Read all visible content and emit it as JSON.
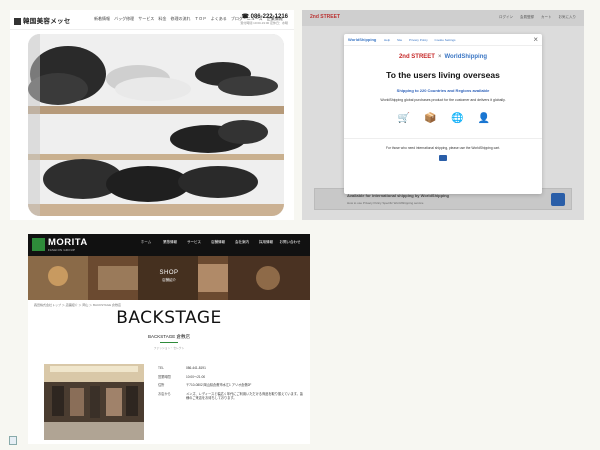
{
  "panel1": {
    "logo": "韓国美容メッセ",
    "nav": [
      "新着情報",
      "バッグ修理",
      "サービス",
      "料金",
      "修理の流れ",
      "ＴＯＰ",
      "よくある",
      "ご質問",
      "ブログ・ニュース",
      "企業情報"
    ],
    "tel": "086-222-1216",
    "tel_sub": "受付時間 10:00-19:00 定休日：水曜"
  },
  "panel2": {
    "header_logo": "2nd STREET",
    "header_icons": [
      "ログイン",
      "会員登録",
      "カート",
      "お気に入り"
    ],
    "bg_text": "",
    "modal": {
      "ws_label": "WorldShipping",
      "links": [
        "Help",
        "Site",
        "Privacy Policy",
        "Cookie Settings"
      ],
      "close": "×",
      "brand_left": "2nd STREET",
      "brand_x": "×",
      "brand_right": "WorldShipping",
      "title": "To the users living overseas",
      "shipping": "Shipping to 220 Countries and Regions available",
      "desc": "WorldShipping global purchases product for the customer and delivers it globally.",
      "footer": "For those who need international shipping, please use the WorldShipping cart."
    },
    "bottom_bar": {
      "title": "Available for international shipping by WorldShipping",
      "links": "How to use    Privacy Policy    Specific WorldShipping service"
    },
    "colors": {
      "brand_red": "#c62828",
      "ws_blue": "#2a5ea8"
    }
  },
  "panel3": {
    "logo": "MORITA",
    "logo_sub": "FASHION GROUP",
    "nav": [
      "ホーム",
      "業態情報",
      "サービス",
      "店舗情報",
      "会社案内",
      "採用情報",
      "お問い合わせ"
    ],
    "hero_title": "SHOP",
    "hero_sub": "店舗紹介",
    "breadcrumb": "森田株式会社トップ ＞ 店舗紹介 ＞ 岡山 ＞ BACKSTAGE 倉敷店",
    "title": "BACKSTAGE",
    "subtitle": "BACKSTAGE 倉敷店",
    "small": "ファッション・セレクト",
    "rows": [
      {
        "k": "TEL",
        "v": "086-441-8191"
      },
      {
        "k": "営業時間",
        "v": "10:00～21:00"
      },
      {
        "k": "住所",
        "v": "〒710-0802 岡山県倉敷市水江1 アリオ倉敷2F"
      },
      {
        "k": "お店から",
        "v": "メンズ、レディースと幅広く年代にご利用いただける商品を取り揃えています。皆様のご来店をお待ちしております。"
      }
    ]
  }
}
